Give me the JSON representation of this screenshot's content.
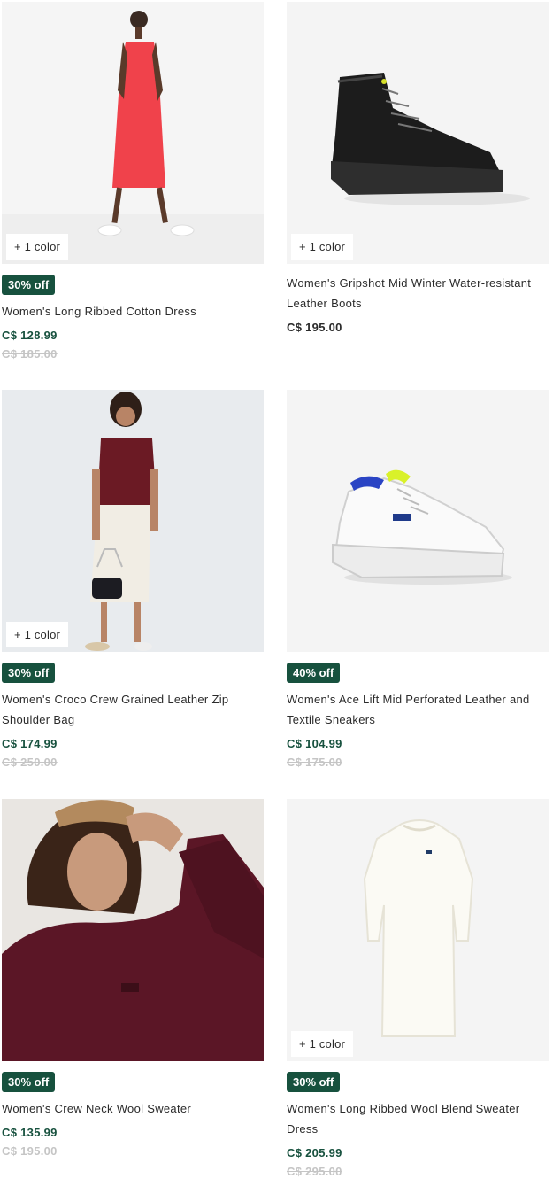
{
  "products": [
    {
      "name": "Women's Long Ribbed Cotton Dress",
      "color_chip": "+ 1 color",
      "badge": "30% off",
      "price": "C$ 128.99",
      "old_price": "C$ 185.00"
    },
    {
      "name": "Women's Gripshot Mid Winter Water-resistant Leather Boots",
      "color_chip": "+ 1 color",
      "badge": "",
      "price": "C$ 195.00",
      "old_price": ""
    },
    {
      "name": "Women's Croco Crew Grained Leather Zip Shoulder Bag",
      "color_chip": "+ 1 color",
      "badge": "30% off",
      "price": "C$ 174.99",
      "old_price": "C$ 250.00"
    },
    {
      "name": "Women's Ace Lift Mid Perforated Leather and Textile Sneakers",
      "color_chip": "",
      "badge": "40% off",
      "price": "C$ 104.99",
      "old_price": "C$ 175.00"
    },
    {
      "name": "Women's Crew Neck Wool Sweater",
      "color_chip": "",
      "badge": "30% off",
      "price": "C$ 135.99",
      "old_price": "C$ 195.00"
    },
    {
      "name": "Women's Long Ribbed Wool Blend Sweater Dress",
      "color_chip": "+ 1 color",
      "badge": "30% off",
      "price": "C$ 205.99",
      "old_price": "C$ 295.00"
    }
  ],
  "colors": {
    "badge_bg": "#17513e",
    "sale_price": "#17513e",
    "old_price": "#c5c5c5",
    "text": "#2b2b2b"
  }
}
